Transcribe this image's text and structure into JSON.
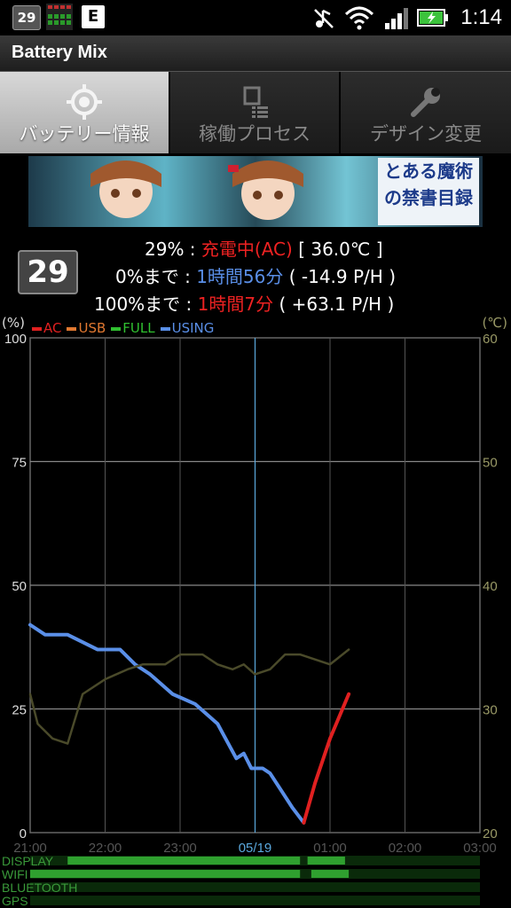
{
  "status_bar": {
    "badge": "29",
    "e_icon": "E",
    "time": "1:14",
    "icons": [
      "battery-badge-icon",
      "level-grid-icon",
      "e-app-icon",
      "mute-icon",
      "wifi-icon",
      "signal-icon",
      "battery-charging-icon"
    ]
  },
  "app": {
    "title": "Battery Mix"
  },
  "tabs": [
    {
      "label": "バッテリー情報",
      "icon": "target-icon",
      "active": true
    },
    {
      "label": "稼働プロセス",
      "icon": "process-list-icon",
      "active": false
    },
    {
      "label": "デザイン変更",
      "icon": "wrench-icon",
      "active": false
    }
  ],
  "banner": {
    "title": "とある魔術の禁書目録"
  },
  "battery": {
    "badge": "29",
    "line1": {
      "percent": "29% :",
      "status": "充電中(AC)",
      "temp": "[ 36.0℃ ]"
    },
    "line2": {
      "label": "0%まで :",
      "time": "1時間56分",
      "rate": "( -14.9 P/H )"
    },
    "line3": {
      "label": "100%まで :",
      "time": "1時間7分",
      "rate": "( +63.1 P/H )"
    }
  },
  "chart_data": {
    "type": "line",
    "left_unit": "(%)",
    "right_unit": "(℃)",
    "legend": [
      {
        "name": "AC",
        "color": "#e02020"
      },
      {
        "name": "USB",
        "color": "#e07830"
      },
      {
        "name": "FULL",
        "color": "#30c030"
      },
      {
        "name": "USING",
        "color": "#5a8fe8"
      }
    ],
    "y_ticks": [
      "100",
      "75",
      "50",
      "25",
      "0"
    ],
    "y_right_ticks": [
      "60",
      "50",
      "40",
      "30",
      "20"
    ],
    "ylim": [
      0,
      100
    ],
    "y_right_lim": [
      20,
      60
    ],
    "x_ticks": [
      "21:00",
      "22:00",
      "23:00",
      "05/19",
      "01:00",
      "02:00",
      "03:00"
    ],
    "x_range_hours": [
      21,
      27
    ],
    "marker_hour": 24,
    "series": [
      {
        "name": "USING",
        "color": "#5a8fe8",
        "x": [
          21.0,
          21.2,
          21.5,
          21.9,
          22.2,
          22.4,
          22.6,
          22.9,
          23.2,
          23.5,
          23.75,
          23.85,
          23.95,
          24.1,
          24.2,
          24.5,
          24.65
        ],
        "y": [
          42,
          40,
          40,
          37,
          37,
          34,
          32,
          28,
          26,
          22,
          15,
          16,
          13,
          13,
          12,
          5,
          2
        ]
      },
      {
        "name": "AC",
        "color": "#e02020",
        "x": [
          24.65,
          24.8,
          25.0,
          25.25
        ],
        "y": [
          2,
          10,
          19,
          28
        ]
      },
      {
        "name": "温度",
        "color": "#4a4a2a",
        "x": [
          21.0,
          21.1,
          21.3,
          21.5,
          21.7,
          22.0,
          22.3,
          22.5,
          22.8,
          23.0,
          23.3,
          23.5,
          23.7,
          23.85,
          24.0,
          24.2,
          24.4,
          24.6,
          24.8,
          25.0,
          25.25
        ],
        "y": [
          28,
          22,
          19,
          18,
          28,
          31,
          33,
          34,
          34,
          36,
          36,
          34,
          33,
          34,
          32,
          33,
          36,
          36,
          35,
          34,
          37
        ]
      }
    ]
  },
  "activity": {
    "labels": [
      "DISPLAY",
      "WIFI",
      "BLUETOOTH",
      "GPS"
    ],
    "colors": {
      "on": "#2fa02f",
      "off": "#0a2a0a"
    },
    "display_segments": [
      [
        21.5,
        24.6
      ],
      [
        24.7,
        25.2
      ]
    ],
    "wifi_segments": [
      [
        21.0,
        24.6
      ],
      [
        24.75,
        25.25
      ]
    ]
  }
}
